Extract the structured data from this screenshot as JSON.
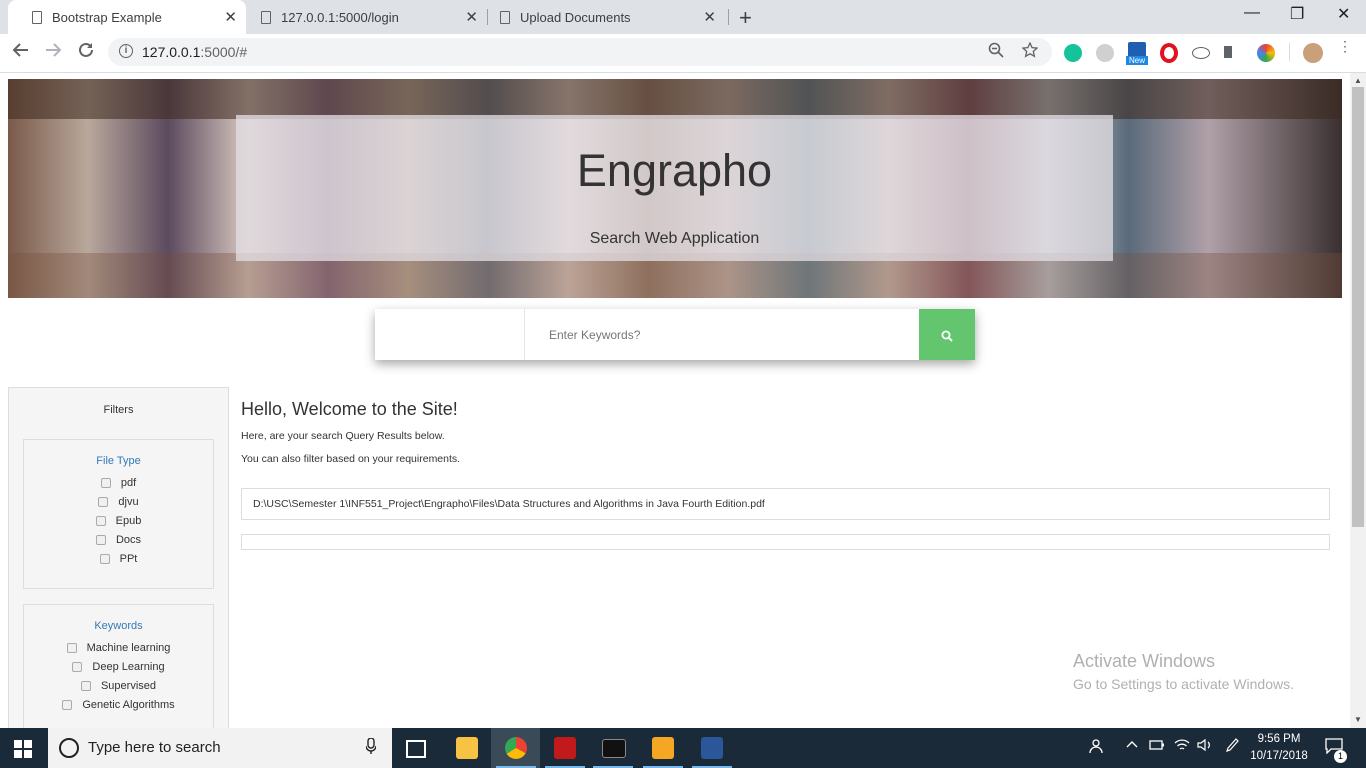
{
  "browser": {
    "tabs": [
      {
        "label": "Bootstrap Example",
        "active": true
      },
      {
        "label": "127.0.0.1:5000/login",
        "active": false
      },
      {
        "label": "Upload Documents",
        "active": false
      }
    ],
    "tab_close": "✕",
    "new_tab": "+",
    "url_host": "127.0.0.1",
    "url_rest": ":5000/#",
    "extension_new_badge": "New",
    "window_controls": {
      "minimize": "—",
      "restore": "❐",
      "close": "✕"
    }
  },
  "hero": {
    "title": "Engrapho",
    "subtitle": "Search Web Application"
  },
  "search": {
    "placeholder": "Enter Keywords?",
    "button_icon": "search-icon",
    "accent_color": "#63c66f"
  },
  "filters": {
    "title": "Filters",
    "file_type": {
      "heading": "File Type",
      "options": [
        "pdf",
        "djvu",
        "Epub",
        "Docs",
        "PPt"
      ]
    },
    "keywords": {
      "heading": "Keywords",
      "options": [
        "Machine learning",
        "Deep Learning",
        "Supervised",
        "Genetic Algorithms"
      ]
    }
  },
  "main": {
    "welcome": "Hello, Welcome to the Site!",
    "line1": "Here, are your search Query Results below.",
    "line2": "You can also filter based on your requirements.",
    "results": [
      "D:\\USC\\Semester 1\\INF551_Project\\Engrapho\\Files\\Data Structures and Algorithms in Java Fourth Edition.pdf",
      ""
    ]
  },
  "watermark": {
    "line1": "Activate Windows",
    "line2": "Go to Settings to activate Windows."
  },
  "taskbar": {
    "search_placeholder": "Type here to search",
    "time": "9:56 PM",
    "date": "10/17/2018",
    "notification_count": "1"
  }
}
